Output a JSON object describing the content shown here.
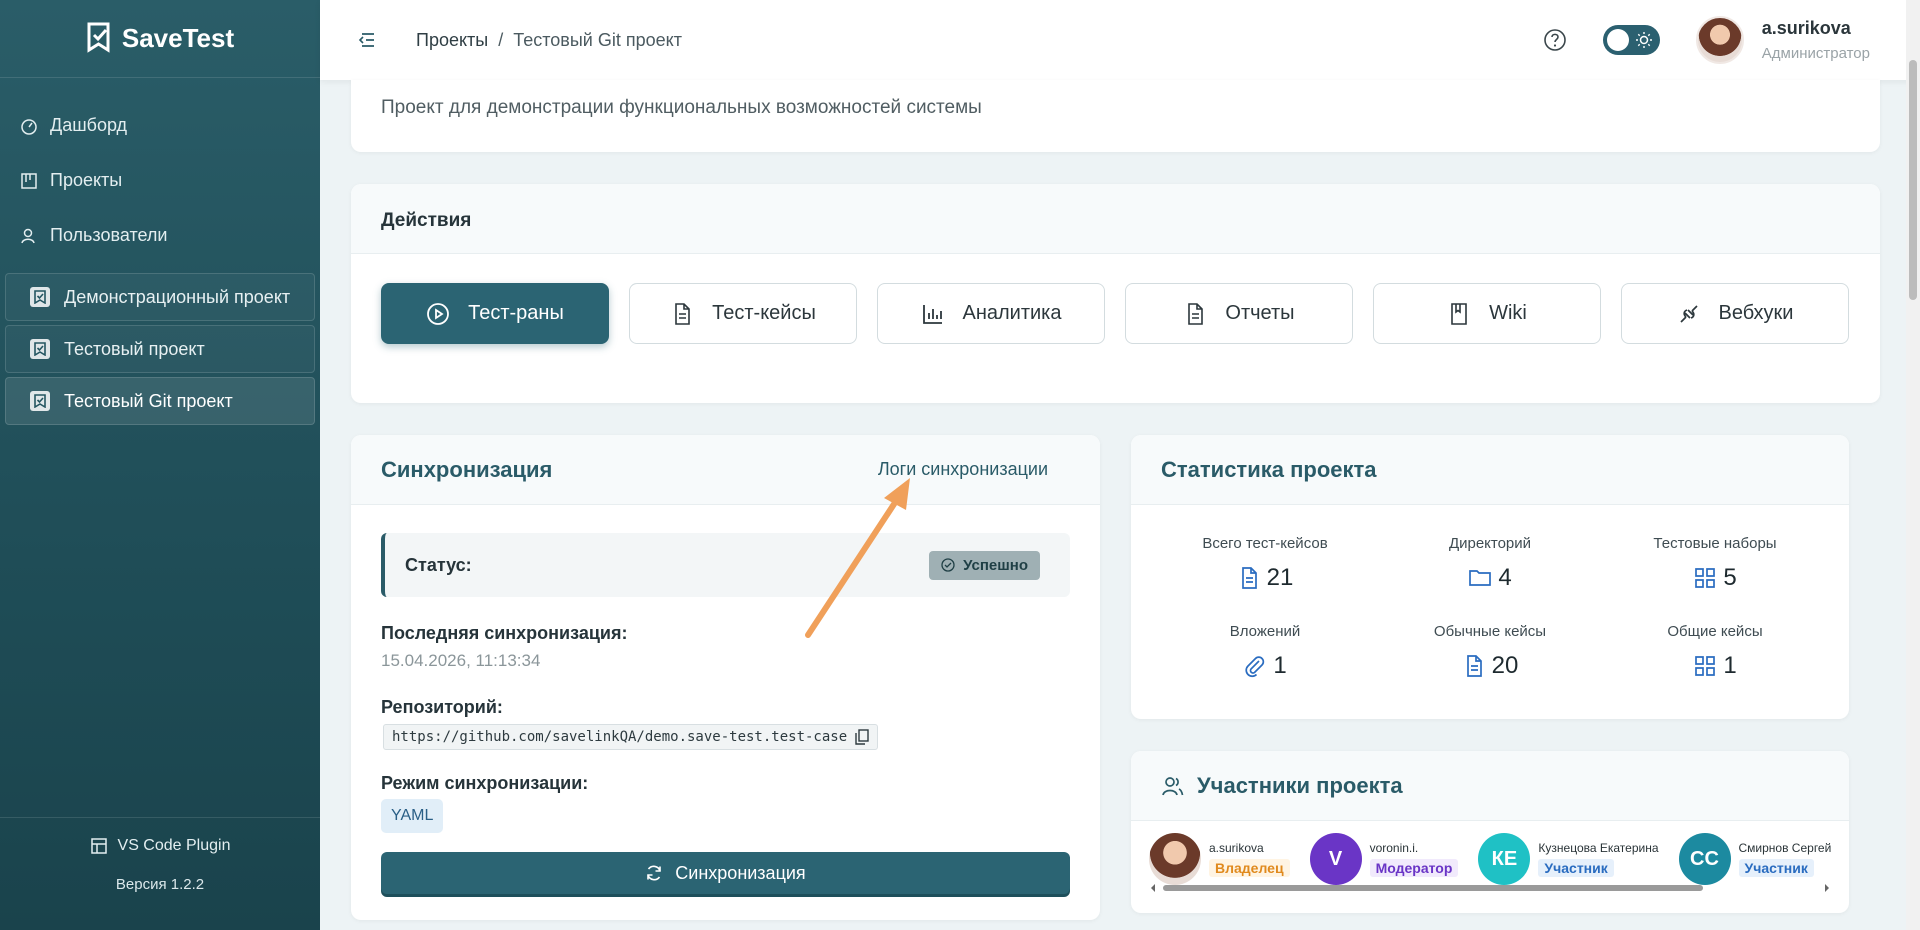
{
  "brand": {
    "name": "SaveTest"
  },
  "sidebar": {
    "nav": [
      {
        "label": "Дашборд",
        "icon": "dashboard-icon"
      },
      {
        "label": "Проекты",
        "icon": "projects-icon"
      },
      {
        "label": "Пользователи",
        "icon": "users-icon"
      }
    ],
    "projects": [
      {
        "label": "Демонстрационный проект"
      },
      {
        "label": "Тестовый проект"
      },
      {
        "label": "Тестовый Git проект",
        "active": true
      }
    ],
    "plugin_label": "VS Code Plugin",
    "version": "Версия 1.2.2"
  },
  "topbar": {
    "breadcrumb": {
      "root": "Проекты",
      "separator": "/",
      "current": "Тестовый Git проект"
    },
    "user": {
      "name": "a.surikova",
      "role": "Администратор"
    }
  },
  "description": "Проект для демонстрации функциональных возможностей системы",
  "actions": {
    "title": "Действия",
    "buttons": [
      {
        "label": "Тест-раны",
        "icon": "play-icon"
      },
      {
        "label": "Тест-кейсы",
        "icon": "document-icon"
      },
      {
        "label": "Аналитика",
        "icon": "chart-icon"
      },
      {
        "label": "Отчеты",
        "icon": "report-icon"
      },
      {
        "label": "Wiki",
        "icon": "book-icon"
      },
      {
        "label": "Вебхуки",
        "icon": "webhook-icon"
      }
    ]
  },
  "sync": {
    "title": "Синхронизация",
    "logs_link": "Логи синхронизации",
    "status_label": "Статус:",
    "status_value": "Успешно",
    "last_sync_label": "Последняя синхронизация:",
    "last_sync_value": "15.04.2026, 11:13:34",
    "repo_label": "Репозиторий:",
    "repo_url": "https://github.com/savelinkQA/demo.save-test.test-case",
    "mode_label": "Режим синхронизации:",
    "mode_value": "YAML",
    "button_label": "Синхронизация"
  },
  "stats": {
    "title": "Статистика проекта",
    "items": [
      {
        "label": "Всего тест-кейсов",
        "value": "21",
        "icon": "document-icon"
      },
      {
        "label": "Директорий",
        "value": "4",
        "icon": "folder-icon"
      },
      {
        "label": "Тестовые наборы",
        "value": "5",
        "icon": "grid-icon"
      },
      {
        "label": "Вложений",
        "value": "1",
        "icon": "paperclip-icon"
      },
      {
        "label": "Обычные кейсы",
        "value": "20",
        "icon": "document-icon"
      },
      {
        "label": "Общие кейсы",
        "value": "1",
        "icon": "grid-icon"
      }
    ]
  },
  "members": {
    "title": "Участники проекта",
    "list": [
      {
        "name": "a.surikova",
        "role": "Владелец",
        "initials": "",
        "color": "#7a4a3a",
        "role_color": "#e08a1e"
      },
      {
        "name": "voronin.i.",
        "role": "Модератор",
        "initials": "V",
        "color": "#6a35c6",
        "role_color": "#6a35c6"
      },
      {
        "name": "Кузнецова Екатерина",
        "role": "Участник",
        "initials": "КЕ",
        "color": "#1fc1c5",
        "role_color": "#2a6cc0"
      },
      {
        "name": "Смирнов Сергей",
        "role": "Участник",
        "initials": "СС",
        "color": "#1c8aa0",
        "role_color": "#2a6cc0"
      }
    ]
  },
  "colors": {
    "primary": "#2b6473",
    "sidebar": "#245661",
    "accent": "#2a5b68"
  }
}
